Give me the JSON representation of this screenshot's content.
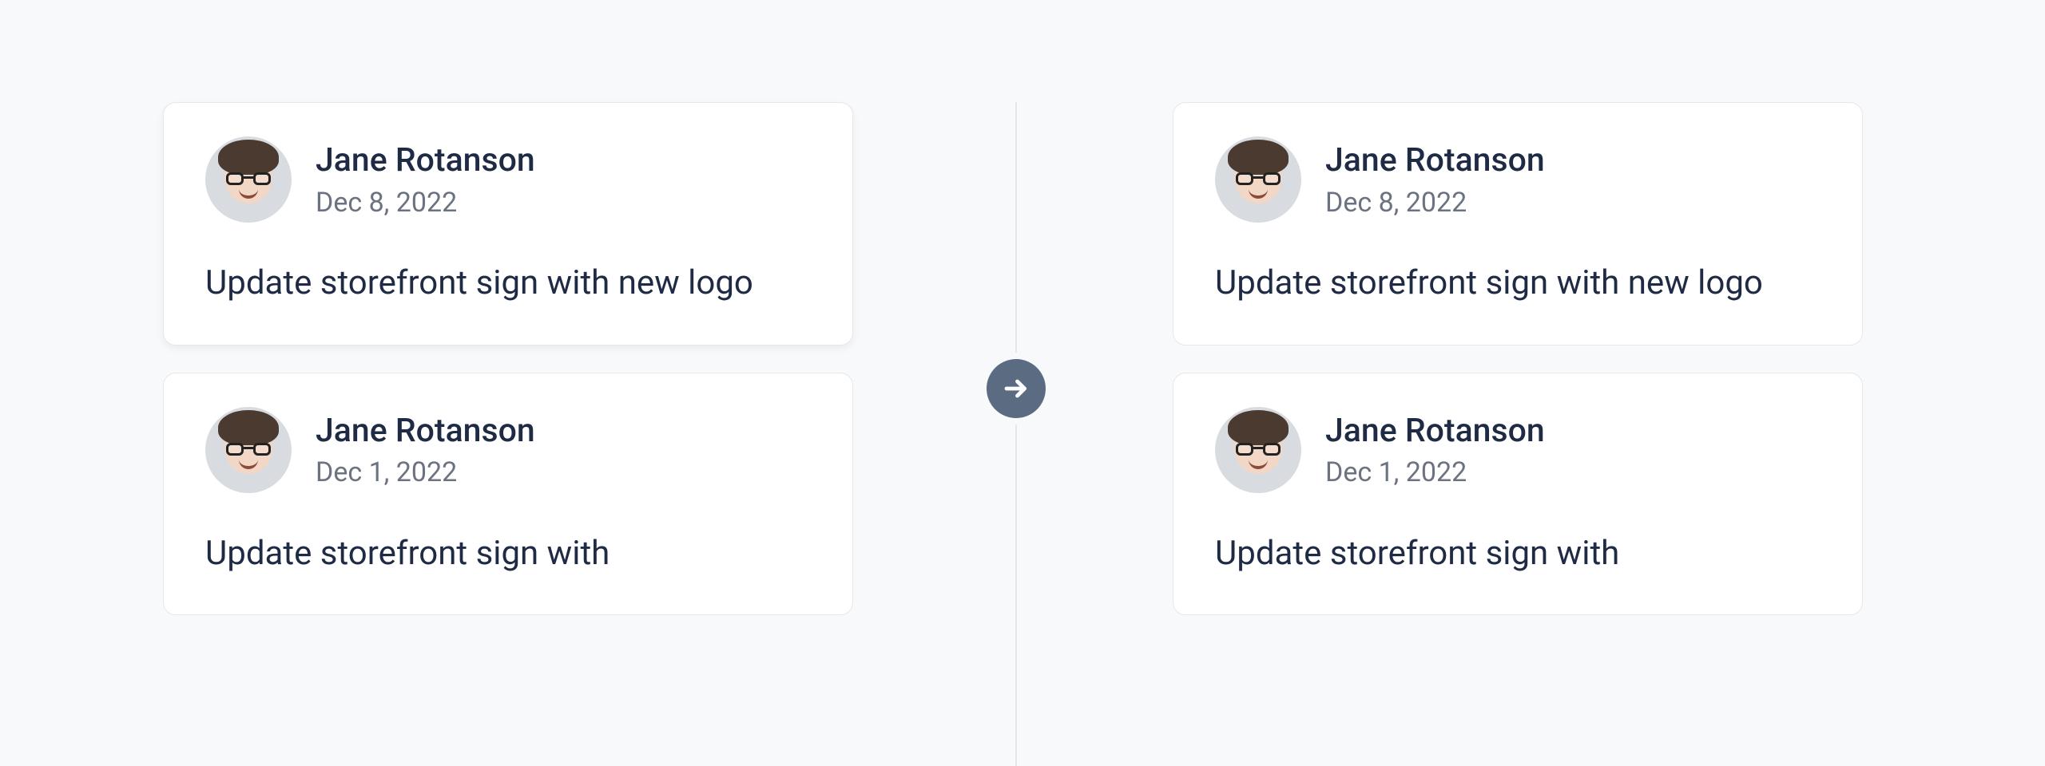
{
  "colors": {
    "page_bg": "#f8f9fb",
    "card_bg": "#ffffff",
    "card_border": "#e5e7eb",
    "text_primary": "#1f2a44",
    "text_secondary": "#6b7280",
    "divider": "#e5e7eb",
    "arrow_badge_bg": "#5b6b82",
    "arrow_glyph": "#ffffff"
  },
  "arrow_icon": "arrow-right",
  "left_column": {
    "cards": [
      {
        "author": "Jane Rotanson",
        "date": "Dec 8, 2022",
        "title": "Update storefront sign with new logo",
        "elevated": true
      },
      {
        "author": "Jane Rotanson",
        "date": "Dec 1, 2022",
        "title": "Update storefront sign with",
        "elevated": false
      }
    ]
  },
  "right_column": {
    "cards": [
      {
        "author": "Jane Rotanson",
        "date": "Dec 8, 2022",
        "title": "Update storefront sign with new logo",
        "elevated": false
      },
      {
        "author": "Jane Rotanson",
        "date": "Dec 1, 2022",
        "title": "Update storefront sign with",
        "elevated": false
      }
    ]
  }
}
